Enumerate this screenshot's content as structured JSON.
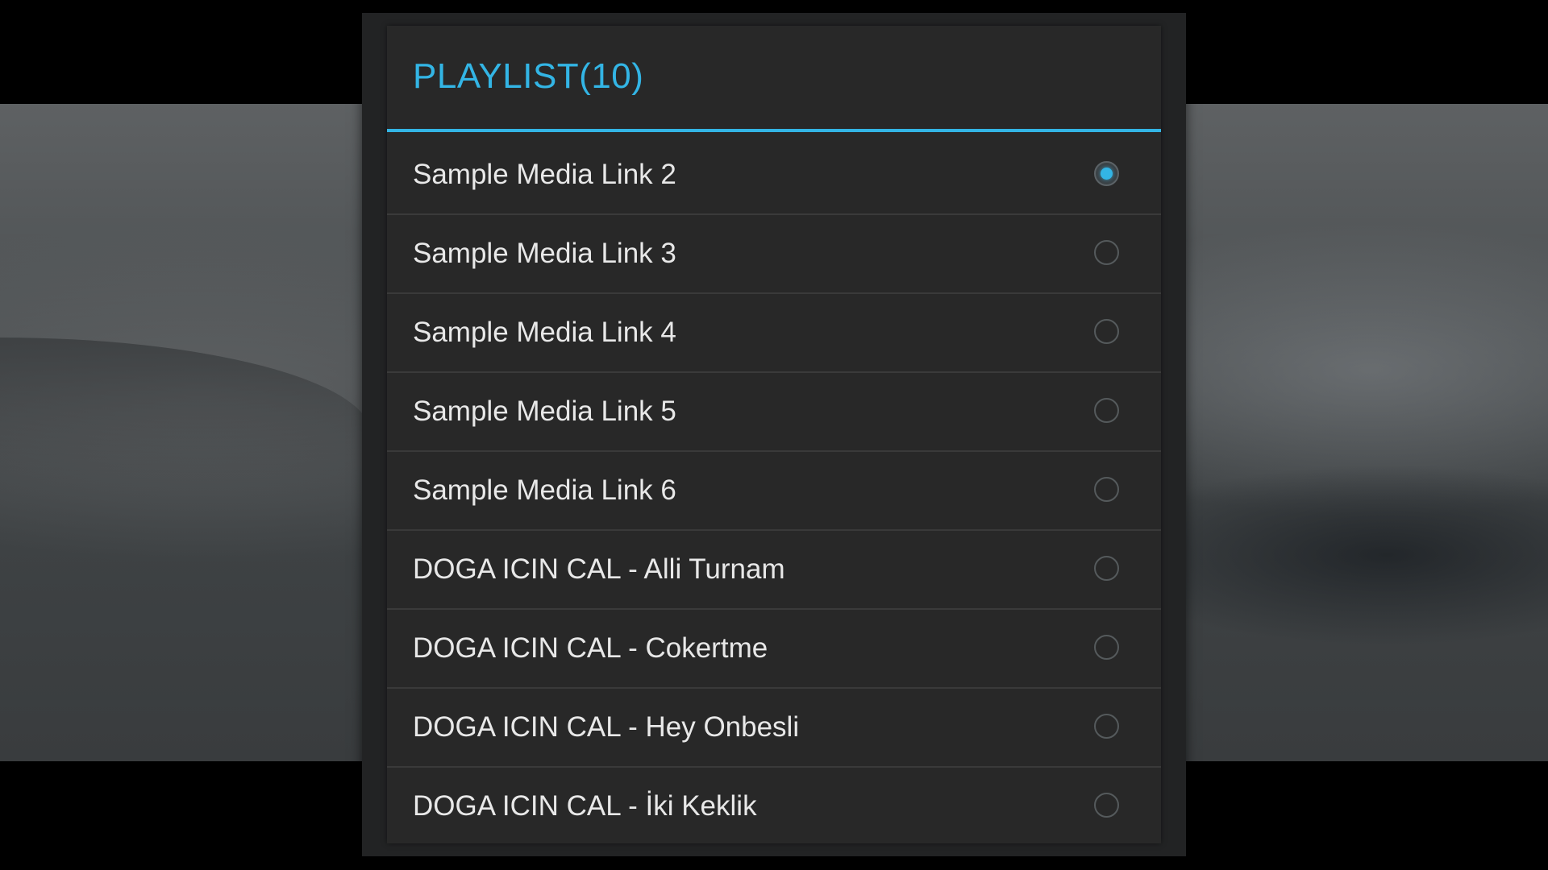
{
  "dialog": {
    "title": "PLAYLIST(10)"
  },
  "colors": {
    "accent": "#33b5e5",
    "dialog_background": "#282828",
    "text": "#e8e8e8"
  },
  "playlist": {
    "selected_index": 0,
    "items": [
      {
        "label": "Sample Media Link 2",
        "selected": true
      },
      {
        "label": "Sample Media Link 3",
        "selected": false
      },
      {
        "label": "Sample Media Link 4",
        "selected": false
      },
      {
        "label": "Sample Media Link 5",
        "selected": false
      },
      {
        "label": "Sample Media Link 6",
        "selected": false
      },
      {
        "label": "DOGA ICIN CAL - Alli Turnam",
        "selected": false
      },
      {
        "label": "DOGA ICIN CAL - Cokertme",
        "selected": false
      },
      {
        "label": "DOGA ICIN CAL - Hey Onbesli",
        "selected": false
      },
      {
        "label": "DOGA ICIN CAL - İki Keklik",
        "selected": false
      }
    ]
  }
}
